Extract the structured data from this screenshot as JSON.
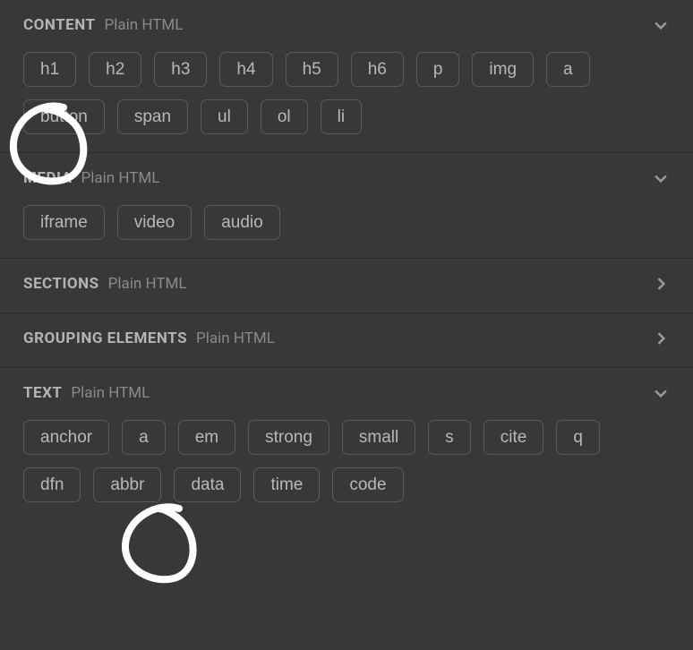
{
  "sections": [
    {
      "id": "content",
      "title": "CONTENT",
      "sub": "Plain HTML",
      "expanded": true,
      "items": [
        "h1",
        "h2",
        "h3",
        "h4",
        "h5",
        "h6",
        "p",
        "img",
        "a",
        "button",
        "span",
        "ul",
        "ol",
        "li"
      ]
    },
    {
      "id": "media",
      "title": "MEDIA",
      "sub": "Plain HTML",
      "expanded": true,
      "items": [
        "iframe",
        "video",
        "audio"
      ]
    },
    {
      "id": "sections",
      "title": "SECTIONS",
      "sub": "Plain HTML",
      "expanded": false,
      "items": []
    },
    {
      "id": "grouping",
      "title": "GROUPING ELEMENTS",
      "sub": "Plain HTML",
      "expanded": false,
      "items": []
    },
    {
      "id": "text",
      "title": "TEXT",
      "sub": "Plain HTML",
      "expanded": true,
      "items": [
        "anchor",
        "a",
        "em",
        "strong",
        "small",
        "s",
        "cite",
        "q",
        "dfn",
        "abbr",
        "data",
        "time",
        "code"
      ]
    }
  ]
}
